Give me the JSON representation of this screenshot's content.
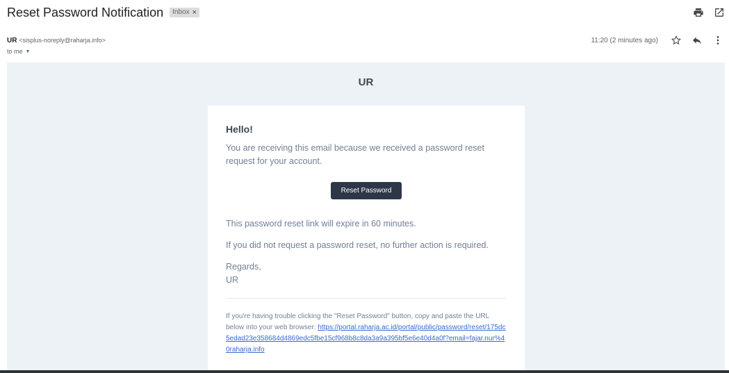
{
  "header": {
    "subject": "Reset Password Notification",
    "label": "Inbox",
    "label_remove": "×"
  },
  "sender": {
    "name": "UR",
    "email": "<sisplus-noreply@raharja.info>",
    "to_label": "to me",
    "timestamp": "11:20 (2 minutes ago)"
  },
  "icons": {
    "print": "printer-icon",
    "new_window": "open-in-new-icon",
    "star": "star-icon",
    "reply": "reply-icon",
    "more": "more-vert-icon"
  },
  "email": {
    "brand": "UR",
    "greeting": "Hello!",
    "intro": "You are receiving this email because we received a password reset request for your account.",
    "button_label": "Reset Password",
    "expire_line": "This password reset link will expire in 60 minutes.",
    "no_action_line": "If you did not request a password reset, no further action is required.",
    "regards": "Regards,",
    "signature": "UR",
    "subcopy_text": "If you're having trouble clicking the \"Reset Password\" button, copy and paste the URL below into your web browser: ",
    "reset_url": "https://portal.raharja.ac.id/portal/public/password/reset/175dc5edad23e358684d4869edc5fbe15cf968b8c8da3a9a395bf5e6e40d4a0f?email=fajar.nur%40raharja.info"
  },
  "colors": {
    "canvas_bg": "#edf2f7",
    "button_bg": "#2d3748",
    "link": "#3869d4",
    "text_muted": "#718096"
  }
}
